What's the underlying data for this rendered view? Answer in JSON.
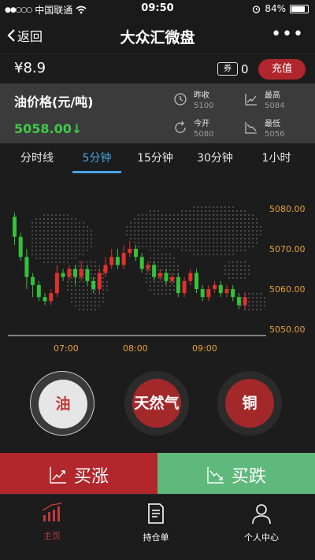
{
  "status_bar": {
    "carrier": "中国联通",
    "time": "09:50",
    "battery": "84%",
    "battery_level": 0.84
  },
  "nav": {
    "back_label": "返回",
    "title": "大众汇微盘"
  },
  "account": {
    "balance": "¥8.9",
    "coupon_label": "券",
    "coupon_count": "0",
    "topup_label": "充值"
  },
  "quote": {
    "label": "油价格(元/吨)",
    "current": "5058.00",
    "direction_arrow": "↓",
    "stats": [
      {
        "key": "昨收",
        "value": "5100",
        "icon": "clock-icon"
      },
      {
        "key": "最高",
        "value": "5084",
        "icon": "trend-up-icon"
      },
      {
        "key": "今开",
        "value": "5080",
        "icon": "refresh-icon"
      },
      {
        "key": "最低",
        "value": "5056",
        "icon": "trend-down-icon"
      }
    ]
  },
  "tabs": [
    "分时线",
    "5分钟",
    "15分钟",
    "30分钟",
    "1小时"
  ],
  "active_tab": "5分钟",
  "chart_data": {
    "type": "candlestick",
    "y_ticks": [
      "5080.00",
      "5070.00",
      "5060.00",
      "5050.00"
    ],
    "ylim": [
      5050,
      5080
    ],
    "x_ticks": [
      "07:00",
      "08:00",
      "09:00"
    ],
    "colors": {
      "up": "#e0312f",
      "down": "#35c13a",
      "tick": "#e8a13a"
    },
    "candles": [
      {
        "o": 5078,
        "c": 5073,
        "h": 5079,
        "l": 5071
      },
      {
        "o": 5073,
        "c": 5068,
        "h": 5074,
        "l": 5067
      },
      {
        "o": 5068,
        "c": 5063,
        "h": 5070,
        "l": 5060
      },
      {
        "o": 5063,
        "c": 5061,
        "h": 5064,
        "l": 5058
      },
      {
        "o": 5061,
        "c": 5058,
        "h": 5062,
        "l": 5057
      },
      {
        "o": 5058,
        "c": 5057,
        "h": 5059,
        "l": 5056
      },
      {
        "o": 5057,
        "c": 5059,
        "h": 5060,
        "l": 5056
      },
      {
        "o": 5059,
        "c": 5064,
        "h": 5066,
        "l": 5058
      },
      {
        "o": 5064,
        "c": 5063,
        "h": 5065,
        "l": 5062
      },
      {
        "o": 5063,
        "c": 5065,
        "h": 5066,
        "l": 5062
      },
      {
        "o": 5065,
        "c": 5063,
        "h": 5066,
        "l": 5061
      },
      {
        "o": 5063,
        "c": 5065,
        "h": 5067,
        "l": 5062
      },
      {
        "o": 5065,
        "c": 5062,
        "h": 5066,
        "l": 5061
      },
      {
        "o": 5062,
        "c": 5060,
        "h": 5063,
        "l": 5059
      },
      {
        "o": 5060,
        "c": 5064,
        "h": 5065,
        "l": 5059
      },
      {
        "o": 5064,
        "c": 5066,
        "h": 5068,
        "l": 5063
      },
      {
        "o": 5066,
        "c": 5068,
        "h": 5070,
        "l": 5065
      },
      {
        "o": 5068,
        "c": 5066,
        "h": 5070,
        "l": 5065
      },
      {
        "o": 5066,
        "c": 5069,
        "h": 5071,
        "l": 5065
      },
      {
        "o": 5069,
        "c": 5070,
        "h": 5072,
        "l": 5068
      },
      {
        "o": 5070,
        "c": 5068,
        "h": 5071,
        "l": 5067
      },
      {
        "o": 5068,
        "c": 5065,
        "h": 5069,
        "l": 5064
      },
      {
        "o": 5065,
        "c": 5066,
        "h": 5067,
        "l": 5064
      },
      {
        "o": 5066,
        "c": 5063,
        "h": 5067,
        "l": 5062
      },
      {
        "o": 5063,
        "c": 5064,
        "h": 5065,
        "l": 5062
      },
      {
        "o": 5064,
        "c": 5062,
        "h": 5065,
        "l": 5061
      },
      {
        "o": 5062,
        "c": 5063,
        "h": 5064,
        "l": 5061
      },
      {
        "o": 5063,
        "c": 5059,
        "h": 5064,
        "l": 5058
      },
      {
        "o": 5059,
        "c": 5062,
        "h": 5063,
        "l": 5058
      },
      {
        "o": 5062,
        "c": 5064,
        "h": 5065,
        "l": 5061
      },
      {
        "o": 5064,
        "c": 5060,
        "h": 5065,
        "l": 5059
      },
      {
        "o": 5060,
        "c": 5058,
        "h": 5061,
        "l": 5057
      },
      {
        "o": 5058,
        "c": 5060,
        "h": 5061,
        "l": 5057
      },
      {
        "o": 5060,
        "c": 5061,
        "h": 5062,
        "l": 5059
      },
      {
        "o": 5061,
        "c": 5059,
        "h": 5062,
        "l": 5058
      },
      {
        "o": 5059,
        "c": 5060,
        "h": 5061,
        "l": 5058
      },
      {
        "o": 5060,
        "c": 5058,
        "h": 5061,
        "l": 5057
      },
      {
        "o": 5058,
        "c": 5056,
        "h": 5059,
        "l": 5055
      },
      {
        "o": 5056,
        "c": 5058,
        "h": 5059,
        "l": 5055
      }
    ]
  },
  "products": [
    {
      "label": "油",
      "active": true
    },
    {
      "label": "天然气",
      "active": false
    },
    {
      "label": "铜",
      "active": false
    }
  ],
  "trade": {
    "buy_up": "买涨",
    "buy_down": "买跌"
  },
  "tabbar": [
    {
      "label": "主页",
      "icon": "chart-bar-icon",
      "active": true
    },
    {
      "label": "持仓单",
      "icon": "document-icon",
      "active": false
    },
    {
      "label": "个人中心",
      "icon": "user-icon",
      "active": false
    }
  ]
}
